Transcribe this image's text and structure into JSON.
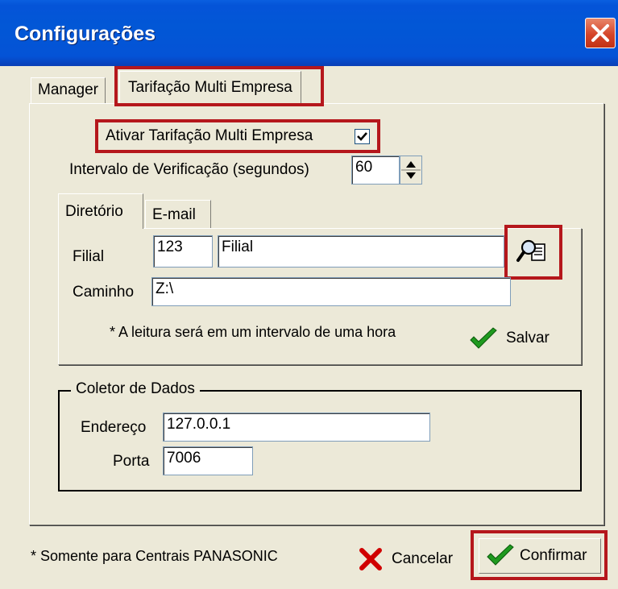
{
  "window": {
    "title": "Configurações"
  },
  "tabs": {
    "manager": "Manager",
    "tarifacao": "Tarifação Multi Empresa"
  },
  "settings": {
    "enable_label": "Ativar Tarifação Multi Empresa",
    "enable_checked": true,
    "interval_label": "Intervalo de Verificação (segundos)",
    "interval_value": "60"
  },
  "inner_tabs": {
    "diretorio": "Diretório",
    "email": "E-mail"
  },
  "directory": {
    "filial_label": "Filial",
    "filial_code": "123",
    "filial_name": "Filial",
    "caminho_label": "Caminho",
    "caminho_value": "Z:\\",
    "note": "* A leitura será em um intervalo de uma hora",
    "save_label": "Salvar"
  },
  "collector": {
    "group_label": "Coletor de Dados",
    "endereco_label": "Endereço",
    "endereco_value": "127.0.0.1",
    "porta_label": "Porta",
    "porta_value": "7006"
  },
  "footer": {
    "note": "* Somente para Centrais PANASONIC",
    "cancel_label": "Cancelar",
    "confirm_label": "Confirmar"
  },
  "colors": {
    "titlebar": "#0454d8",
    "highlight": "#b5171c",
    "check_green": "#1f9a1f",
    "cancel_red": "#d00000"
  }
}
